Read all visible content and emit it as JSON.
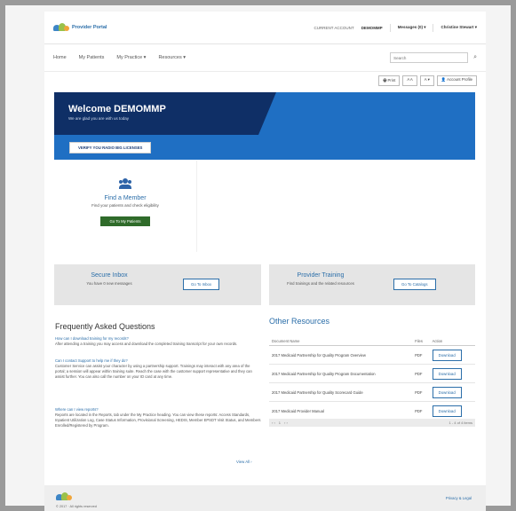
{
  "header": {
    "portal_name": "Provider Portal",
    "account_label": "CURRENT ACCOUNT",
    "account_value": "DEMOMMP",
    "messages": "Messages (0) ▾",
    "user": "Christine Stewart ▾"
  },
  "nav": {
    "items": [
      "Home",
      "My Patients",
      "My Practice ▾",
      "Resources ▾"
    ],
    "search_placeholder": "Search"
  },
  "toolbar": {
    "buttons": [
      "🖶 Print",
      "A A",
      "A ▾",
      "👤 Account Profile"
    ]
  },
  "hero": {
    "title": "Welcome DEMOMMP",
    "subtitle": "We are glad you are with us today",
    "button": "VERIFY YOU RADIO BIG LICENSES"
  },
  "member": {
    "title": "Find a Member",
    "subtitle": "Find your patients and check eligibility",
    "button": "Go To My Patients"
  },
  "cards": {
    "inbox_title": "Secure Inbox",
    "inbox_sub": "You have 0 new messages",
    "inbox_button": "Go To Inbox",
    "training_title": "Provider Training",
    "training_sub": "Find trainings and the related resources",
    "training_button": "Go To Catalogs"
  },
  "faq": {
    "title": "Frequently Asked Questions",
    "items": [
      {
        "q": "How can I download training for my records?",
        "a": "After attending a training you may access and download the completed training transcript for your own records."
      },
      {
        "q": "Can I contact Support to help me if they do?",
        "a": "Customer Service can assist your character by using a partnership support. Trainings may interact with any area of the portal; a session will appear within training suite. Reach the case with the customer support representative and they can assist further. You can also call the number on your ID card at any time."
      },
      {
        "q": "Where can I view reports?",
        "a": "Reports are located in the Reports, tab under the My Practice heading. You can view these reports: Access Standards, Inpatient Utilization Log, Case Status Information, Provisional Screening, HEDIS, Member EPSDT Visit Status, and Members Enrolled/Registered by Program."
      }
    ],
    "view_all": "View All ›"
  },
  "resources": {
    "title": "Other Resources",
    "columns": [
      "Document Name",
      "Files",
      "Action"
    ],
    "rows": [
      {
        "name": "2017 Medicaid Partnership for Quality Program Overview",
        "file": "PDF",
        "action": "Download"
      },
      {
        "name": "2017 Medicaid Partnership for Quality Program Documentation",
        "file": "PDF",
        "action": "Download"
      },
      {
        "name": "2017 Medicaid Partnership for Quality Scorecard Guide",
        "file": "PDF",
        "action": "Download"
      },
      {
        "name": "2017 Medicaid Provider Manual",
        "file": "PDF",
        "action": "Download"
      }
    ],
    "pager_prev": "‹ ‹",
    "pager_page": "1",
    "pager_next": "› ›",
    "pager_info": "1 - 4 of 4 items"
  },
  "footer": {
    "copyright": "© 2017 · All rights reserved",
    "privacy": "Privacy & Legal"
  },
  "colors": {
    "brand_blue": "#1f6fc3",
    "dark_blue": "#0f2f66",
    "link": "#2b6ea9",
    "green_button": "#2f6b2a"
  }
}
